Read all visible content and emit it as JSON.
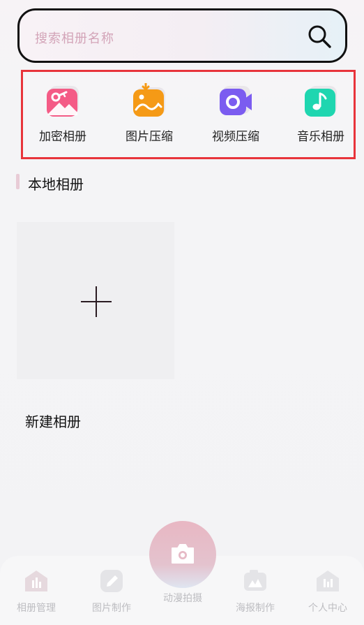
{
  "search": {
    "placeholder": "搜索相册名称"
  },
  "features": [
    {
      "label": "加密相册",
      "icon": "key-image-icon",
      "color": "#f45b86"
    },
    {
      "label": "图片压缩",
      "icon": "image-compress-icon",
      "color": "#f59a16"
    },
    {
      "label": "视频压缩",
      "icon": "video-camera-icon",
      "color": "#7b5cf0"
    },
    {
      "label": "音乐相册",
      "icon": "music-note-icon",
      "color": "#1fd6b0"
    }
  ],
  "section": {
    "title": "本地相册"
  },
  "album": {
    "label": "新建相册",
    "icon": "plus-icon"
  },
  "nav": {
    "items": [
      {
        "label": "相册管理",
        "icon": "album-manage-icon"
      },
      {
        "label": "图片制作",
        "icon": "edit-pencil-icon"
      },
      {
        "label": "动漫拍摄",
        "icon": "camera-icon"
      },
      {
        "label": "海报制作",
        "icon": "poster-icon"
      },
      {
        "label": "个人中心",
        "icon": "profile-icon"
      }
    ]
  }
}
